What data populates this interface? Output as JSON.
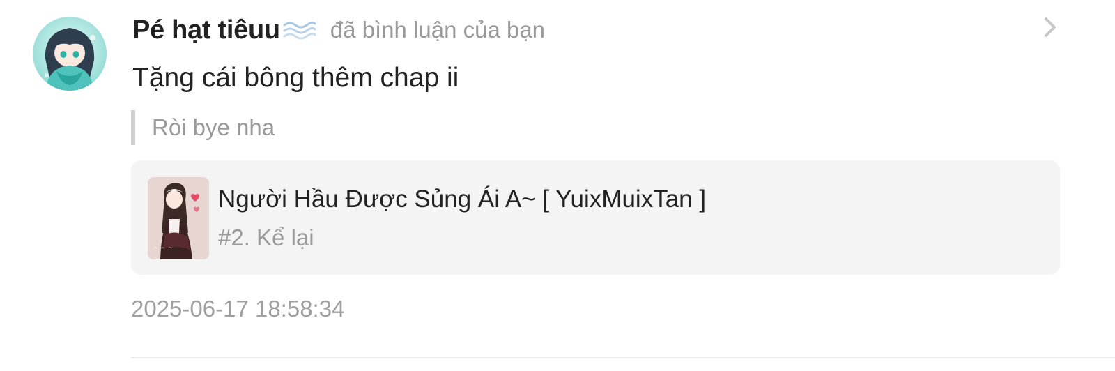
{
  "notification": {
    "username": "Pé hạt tiêuu",
    "username_icon": "wave-icon",
    "action_text": "đã bình luận của bạn",
    "comment_text": "Tặng cái bông thêm chap ii",
    "quoted_reply": "Ròi bye nha",
    "story": {
      "title": "Người Hầu Được Sủng Ái A~ [ YuixMuixTan ]",
      "chapter": "#2. Kể lại",
      "cover_icon": "story-cover-image"
    },
    "timestamp": "2025-06-17 18:58:34",
    "open_icon": "chevron-right-icon"
  },
  "colors": {
    "primary_text": "#222222",
    "secondary_text": "#9a9a9a",
    "card_background": "#f4f4f5",
    "quote_bar": "#cfcfcf",
    "divider": "#ececec",
    "avatar_accent": "#5cc9c2"
  }
}
